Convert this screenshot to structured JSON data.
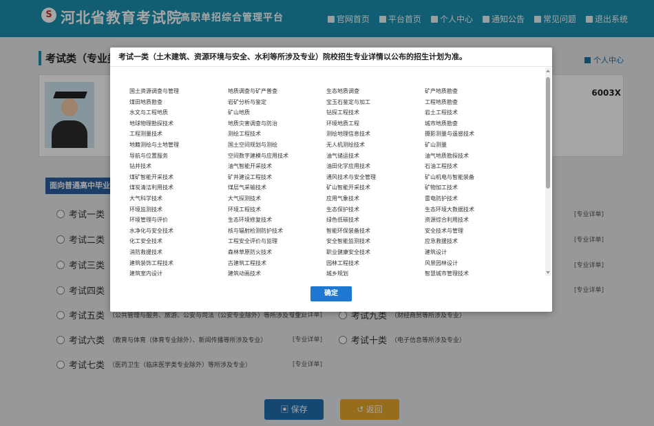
{
  "header": {
    "logo_glyph": "S",
    "site_title": "河北省教育考试院",
    "site_subtitle": "高职单招综合管理平台",
    "nav": [
      {
        "label": "官网首页",
        "icon": "building-icon"
      },
      {
        "label": "平台首页",
        "icon": "home-icon"
      },
      {
        "label": "个人中心",
        "icon": "user-icon"
      },
      {
        "label": "通知公告",
        "icon": "document-icon"
      },
      {
        "label": "常见问题",
        "icon": "question-icon"
      },
      {
        "label": "退出系统",
        "icon": "logout-icon"
      }
    ]
  },
  "page": {
    "title": "考试类（专业类",
    "personal_center": "个人中心",
    "id_fragment": "6003X",
    "section_label": "面向普通高中毕业生",
    "categories_left": [
      {
        "name": "考试一类",
        "desc": ""
      },
      {
        "name": "考试二类",
        "desc": ""
      },
      {
        "name": "考试三类",
        "desc": ""
      },
      {
        "name": "考试四类",
        "desc": ""
      },
      {
        "name": "考试五类",
        "desc": "（公共管理与服务、旅游、公安与司法（公安专业除外）等所涉及专业）"
      },
      {
        "name": "考试六类",
        "desc": "（教育与体育（体育专业除外）、新闻传播等所涉及专业）"
      },
      {
        "name": "考试七类",
        "desc": "（医药卫生（临床医学类专业除外）等所涉及专业）"
      }
    ],
    "categories_right": [
      {
        "name": "考试九类",
        "desc": "（财经商贸等所涉及专业）"
      },
      {
        "name": "考试十类",
        "desc": "（电子信息等所涉及专业）"
      }
    ],
    "detail_label": "[专业详单]",
    "save_label": "保存",
    "back_label": "返回"
  },
  "modal": {
    "title": "考试一类（土木建筑、资源环境与安全、水利等所涉及专业）院校招生专业详情以公布的招生计划为准。",
    "confirm_label": "确定",
    "majors": [
      "国土资源调查与管理",
      "地质调查与矿产普查",
      "生态地质调查",
      "矿产地质勘查",
      "煤田地质勘查",
      "岩矿分析与鉴定",
      "宝玉石鉴定与加工",
      "工程地质勘查",
      "水文与工程地质",
      "矿山地质",
      "钻探工程技术",
      "岩土工程技术",
      "地球物理勘探技术",
      "地质灾害调查与防治",
      "环境地质工程",
      "城市地质勘查",
      "工程测量技术",
      "测绘工程技术",
      "测绘地理信息技术",
      "摄影测量与遥感技术",
      "地籍测绘与土地管理",
      "国土空间规划与测绘",
      "无人机测绘技术",
      "矿山测量",
      "导航与位置服务",
      "空间数字建模与应用技术",
      "油气储运技术",
      "油气地质勘探技术",
      "钻井技术",
      "油气智能开采技术",
      "油田化学应用技术",
      "石油工程技术",
      "煤矿智能开采技术",
      "矿井建设工程技术",
      "通风技术与安全管理",
      "矿山机电与智能装备",
      "煤炭清洁利用技术",
      "煤层气采输技术",
      "矿山智能开采技术",
      "矿物加工技术",
      "大气科学技术",
      "大气探测技术",
      "应用气象技术",
      "雷电防护技术",
      "环境监测技术",
      "环境工程技术",
      "生态保护技术",
      "生态环境大数据技术",
      "环境管理与评价",
      "生态环境修复技术",
      "绿色低碳技术",
      "资源综合利用技术",
      "水净化与安全技术",
      "核与辐射检测防护技术",
      "智能环保装备技术",
      "安全技术与管理",
      "化工安全技术",
      "工程安全评价与监理",
      "安全智能监测技术",
      "应急救援技术",
      "消防救援技术",
      "森林草原防火技术",
      "职业健康安全技术",
      "建筑设计",
      "建筑装饰工程技术",
      "古建筑工程技术",
      "园林工程技术",
      "风景园林设计",
      "建筑室内设计",
      "建筑动画技术",
      "城乡规划",
      "智慧城市管理技术"
    ]
  },
  "colors": {
    "header_bg": "#1b8fb0",
    "confirm_button": "#1e78d2",
    "save_button": "#1f6fb0",
    "back_button": "#e9a82a"
  }
}
